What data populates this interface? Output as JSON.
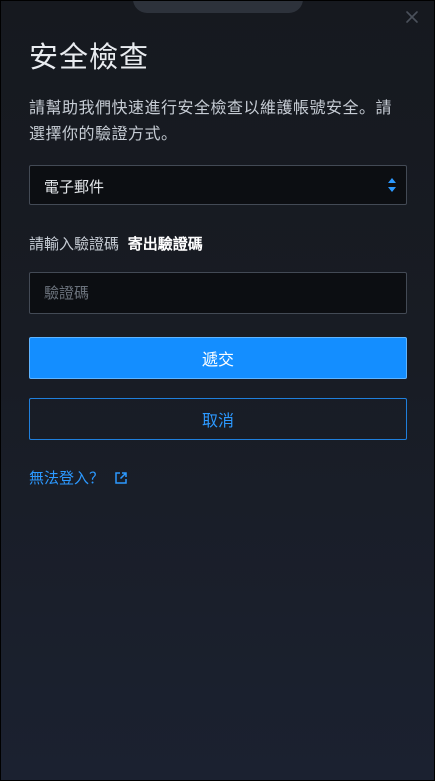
{
  "dialog": {
    "title": "安全檢查",
    "description": "請幫助我們快速進行安全檢查以維護帳號安全。請選擇你的驗證方式。"
  },
  "verification_method": {
    "selected": "電子郵件"
  },
  "code": {
    "prompt": "請輸入驗證碼",
    "send_label": "寄出驗證碼",
    "placeholder": "驗證碼",
    "value": ""
  },
  "actions": {
    "submit_label": "遞交",
    "cancel_label": "取消"
  },
  "help": {
    "cannot_login_label": "無法登入？"
  },
  "icons": {
    "close": "close-icon",
    "select_arrows": "select-arrows-icon",
    "external_link": "external-link-icon"
  },
  "colors": {
    "accent": "#148eff",
    "link": "#2c99ff",
    "background": "#181c24"
  }
}
